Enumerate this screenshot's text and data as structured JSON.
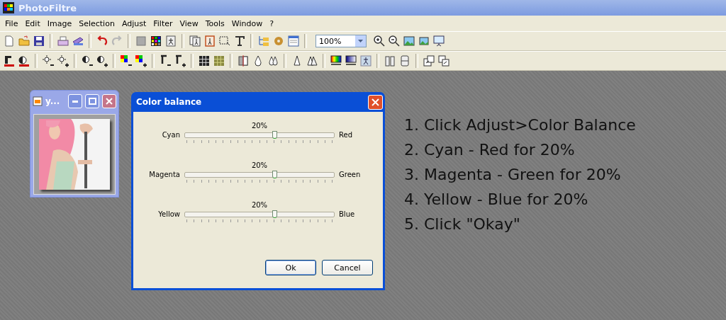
{
  "app": {
    "title": "PhotoFiltre"
  },
  "menu": [
    "File",
    "Edit",
    "Image",
    "Selection",
    "Adjust",
    "Filter",
    "View",
    "Tools",
    "Window",
    "?"
  ],
  "toolbar": {
    "redo_disabled": true,
    "zoom_value": "100%"
  },
  "image_window": {
    "title": "y..."
  },
  "dialog": {
    "title": "Color balance",
    "sliders": [
      {
        "left": "Cyan",
        "right": "Red",
        "reading": "20%",
        "level": 0.6
      },
      {
        "left": "Magenta",
        "right": "Green",
        "reading": "20%",
        "level": 0.6
      },
      {
        "left": "Yellow",
        "right": "Blue",
        "reading": "20%",
        "level": 0.6
      }
    ],
    "buttons": [
      {
        "label": "Ok",
        "default": true
      },
      {
        "label": "Cancel",
        "default": false
      }
    ]
  },
  "instructions": [
    "1. Click Adjust>Color Balance",
    "2. Cyan - Red for 20%",
    "3. Magenta - Green for 20%",
    "4. Yellow - Blue for 20%",
    "5. Click \"Okay\""
  ]
}
